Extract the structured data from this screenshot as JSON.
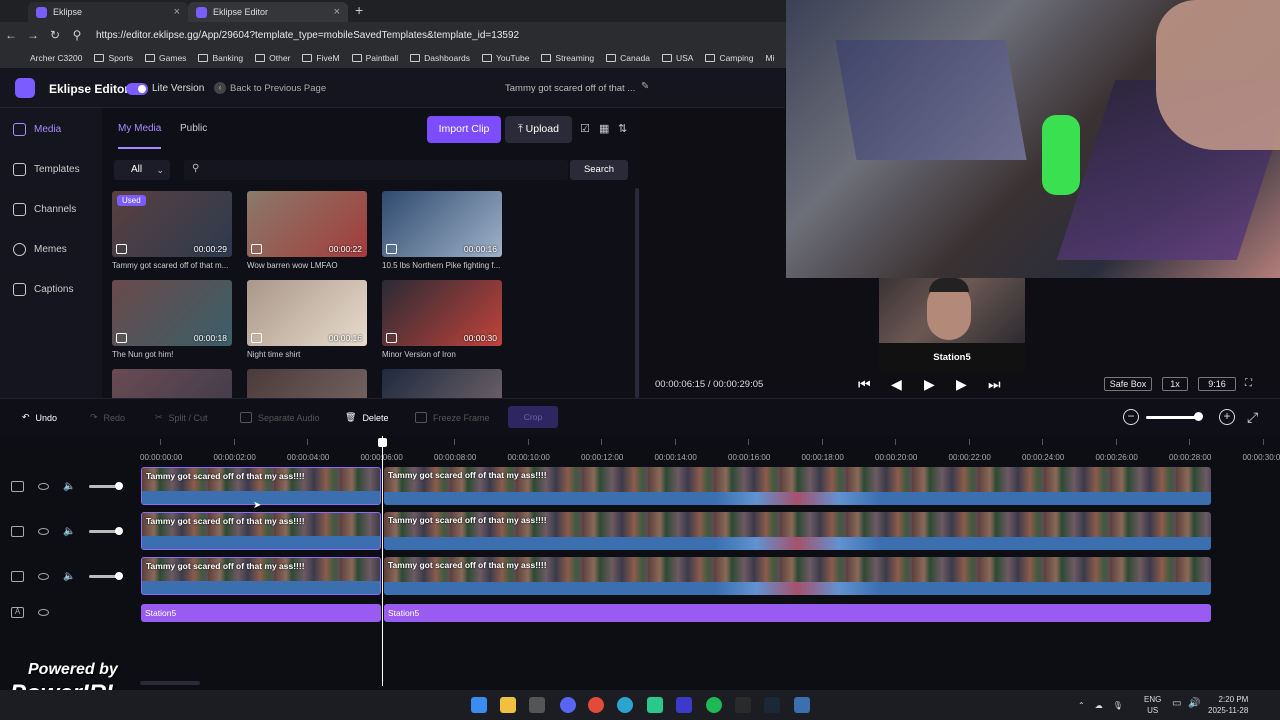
{
  "browser": {
    "tabs": [
      {
        "label": "Eklipse"
      },
      {
        "label": "Eklipse Editor"
      }
    ],
    "url": "https://editor.eklipse.gg/App/29604?template_type=mobileSavedTemplates&template_id=13592",
    "bookmarks": [
      "Archer C3200",
      "Sports",
      "Games",
      "Banking",
      "Other",
      "FiveM",
      "Paintball",
      "Dashboards",
      "YouTube",
      "Streaming",
      "Canada",
      "USA",
      "Camping",
      "Mi"
    ]
  },
  "header": {
    "app_name": "Eklipse Editor",
    "lite_label": "Lite Version",
    "back_label": "Back to Previous Page",
    "clip_title": "Tammy got scared off of that ..."
  },
  "sidebar": {
    "items": [
      {
        "label": "Media"
      },
      {
        "label": "Templates"
      },
      {
        "label": "Channels"
      },
      {
        "label": "Memes"
      },
      {
        "label": "Captions"
      }
    ]
  },
  "media": {
    "tabs": [
      "My Media",
      "Public"
    ],
    "import_label": "Import Clip",
    "upload_label": "Upload",
    "filter_value": "All",
    "search_label": "Search",
    "used_badge": "Used",
    "cards": [
      {
        "title": "Tammy got scared off of that m...",
        "duration": "00:00:29",
        "c1": "#5a4040",
        "c2": "#2c3a4f"
      },
      {
        "title": "Wow barren wow LMFAO",
        "duration": "00:00:22",
        "c1": "#8a7a6a",
        "c2": "#a33c3c"
      },
      {
        "title": "10.5 lbs Northern Pike fighting f...",
        "duration": "00:00:16",
        "c1": "#2f4a6f",
        "c2": "#9fb2c8"
      },
      {
        "title": "The Nun got him!",
        "duration": "00:00:18",
        "c1": "#6a4a4a",
        "c2": "#3a5f6a"
      },
      {
        "title": "Night time shirt",
        "duration": "00:00:16",
        "c1": "#a9978a",
        "c2": "#e8dccd"
      },
      {
        "title": "Minor Version of Iron",
        "duration": "00:00:30",
        "c1": "#2a2a35",
        "c2": "#c1433a"
      },
      {
        "title": "",
        "duration": "",
        "c1": "#6a4a52",
        "c2": "#3b3b4a"
      },
      {
        "title": "",
        "duration": "",
        "c1": "#4a3a3a",
        "c2": "#7a6a6a"
      },
      {
        "title": "",
        "duration": "",
        "c1": "#1e2a3e",
        "c2": "#7a6a70"
      }
    ]
  },
  "preview": {
    "station_label": "Station5",
    "current_time": "00:00:06:15",
    "total_time": "00:00:29:05",
    "safe_box": "Safe Box",
    "speed": "1x",
    "ratio": "9:16"
  },
  "toolbar": {
    "undo": "Undo",
    "redo": "Redo",
    "split": "Split / Cut",
    "separate_audio": "Separate Audio",
    "delete": "Delete",
    "freeze": "Freeze Frame",
    "crop": "Crop"
  },
  "timeline": {
    "ticks": [
      "00:00:00:00",
      "00:00:02:00",
      "00:00:04:00",
      "00:00:06:00",
      "00:00:08:00",
      "00:00:10:00",
      "00:00:12:00",
      "00:00:14:00",
      "00:00:16:00",
      "00:00:18:00",
      "00:00:20:00",
      "00:00:22:00",
      "00:00:24:00",
      "00:00:26:00",
      "00:00:28:00",
      "00:00:30:0"
    ],
    "clip_label": "Tammy got scared off of that my ass!!!!",
    "text_label": "Station5"
  },
  "overlay": {
    "powered": "Powered by",
    "brand": "PowerIRL"
  },
  "taskbar": {
    "lang": "ENG",
    "region": "US",
    "time": "2:20 PM",
    "date": "2025-11-28"
  }
}
